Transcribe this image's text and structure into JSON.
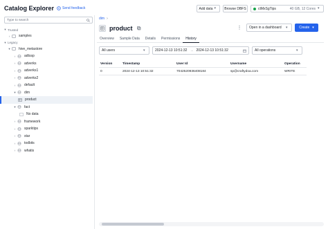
{
  "app": {
    "title": "Catalog Explorer",
    "feedback_label": "Send feedback"
  },
  "toolbar": {
    "add_data_label": "Add data",
    "browse_dbfs_label": "Browse DBFS",
    "compute_name": "ctMxSgTips",
    "compute_info": "40 GB, 12 Cores"
  },
  "sidebar": {
    "filter_placeholder": "Type to search",
    "sections": [
      {
        "label": "Trusted"
      },
      {
        "label": "Legacy"
      }
    ],
    "items": [
      {
        "label": "samples",
        "level": 1
      },
      {
        "label": "hive_metastore",
        "level": 1
      },
      {
        "label": "adtssp",
        "level": 2
      },
      {
        "label": "adverks",
        "level": 2
      },
      {
        "label": "adverks1",
        "level": 2
      },
      {
        "label": "adverks2",
        "level": 2
      },
      {
        "label": "default",
        "level": 2
      },
      {
        "label": "dim",
        "level": 2
      },
      {
        "label": "product",
        "level": 3,
        "selected": true
      },
      {
        "label": "fact",
        "level": 2
      },
      {
        "label": "No data",
        "level": 3
      },
      {
        "label": "framework",
        "level": 2
      },
      {
        "label": "sparktips",
        "level": 2
      },
      {
        "label": "star",
        "level": 2
      },
      {
        "label": "todbits",
        "level": 2
      },
      {
        "label": "whatis",
        "level": 2
      }
    ]
  },
  "main": {
    "breadcrumb": "dim",
    "title": "product",
    "open_dashboard_label": "Open in a dashboard",
    "create_label": "Create",
    "tabs": [
      {
        "label": "Overview",
        "active": false
      },
      {
        "label": "Sample Data",
        "active": false
      },
      {
        "label": "Details",
        "active": false
      },
      {
        "label": "Permissions",
        "active": false
      },
      {
        "label": "History",
        "active": true
      }
    ],
    "filters": {
      "users_value": "All users",
      "date_from": "2024-12-13 10:51:32",
      "date_to": "2024-12-13 10:51:32",
      "operations_value": "All operations"
    },
    "table": {
      "headers": [
        "Version",
        "Timestamp",
        "User Id",
        "Username",
        "Operation"
      ],
      "rows": [
        [
          "0",
          "2024-12-13 10:51:32",
          "7042520936408184",
          "sp@craftydoa.com",
          "WRITE"
        ]
      ]
    }
  }
}
